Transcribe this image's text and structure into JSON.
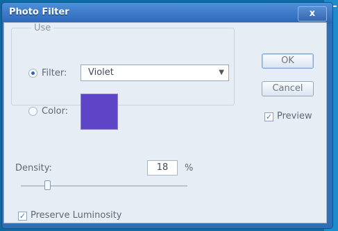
{
  "dialog": {
    "title": "Photo Filter",
    "close_label": "x"
  },
  "use": {
    "legend": "Use",
    "filter_label": "Filter:",
    "filter_selected": "Violet",
    "color_label": "Color:",
    "color_hex": "#5e45c7"
  },
  "buttons": {
    "ok": "OK",
    "cancel": "Cancel"
  },
  "preview": {
    "label": "Preview",
    "checked": true
  },
  "density": {
    "label": "Density:",
    "value": "18",
    "unit": "%",
    "percent": 18
  },
  "preserve_luminosity": {
    "label": "Preserve Luminosity",
    "checked": true
  }
}
